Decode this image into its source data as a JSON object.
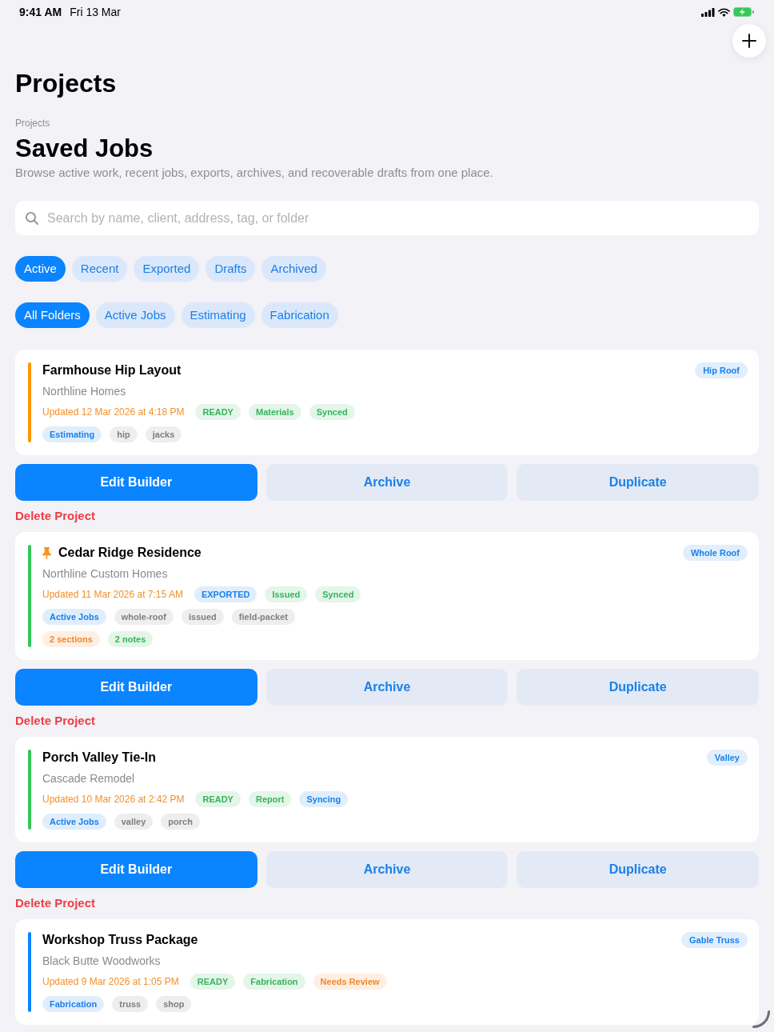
{
  "status_bar": {
    "time": "9:41 AM",
    "date": "Fri 13 Mar"
  },
  "header": {
    "title": "Projects"
  },
  "section": {
    "eyebrow": "Projects",
    "title": "Saved Jobs",
    "description": "Browse active work, recent jobs, exports, archives, and recoverable drafts from one place."
  },
  "search": {
    "placeholder": "Search by name, client, address, tag, or folder"
  },
  "status_filters": [
    {
      "label": "Active",
      "selected": true
    },
    {
      "label": "Recent",
      "selected": false
    },
    {
      "label": "Exported",
      "selected": false
    },
    {
      "label": "Drafts",
      "selected": false
    },
    {
      "label": "Archived",
      "selected": false
    }
  ],
  "folder_filters": [
    {
      "label": "All Folders",
      "selected": true
    },
    {
      "label": "Active Jobs",
      "selected": false
    },
    {
      "label": "Estimating",
      "selected": false
    },
    {
      "label": "Fabrication",
      "selected": false
    }
  ],
  "projects": [
    {
      "title": "Farmhouse Hip Layout",
      "pinned": false,
      "color": "#ff9500",
      "client": "Northline Homes",
      "badge": "Hip Roof",
      "updated": "Updated 12 Mar 2026 at 4:18 PM",
      "status_chips": [
        {
          "label": "READY",
          "color": "#35b55a"
        },
        {
          "label": "Materials",
          "color": "#35b55a"
        },
        {
          "label": "Synced",
          "color": "#35b55a"
        }
      ],
      "tag_rows": [
        {
          "tags": [
            {
              "label": "Estimating",
              "color": "#1a80ea"
            },
            {
              "label": "hip",
              "color": "#7e7e83"
            },
            {
              "label": "jacks",
              "color": "#7e7e83"
            }
          ]
        }
      ],
      "actions": [
        {
          "label": "Edit Builder",
          "kind": "primary"
        },
        {
          "label": "Archive",
          "kind": "secondary"
        },
        {
          "label": "Duplicate",
          "kind": "secondary"
        }
      ],
      "delete": "Delete Project"
    },
    {
      "title": "Cedar Ridge Residence",
      "pinned": true,
      "color": "#34c759",
      "client": "Northline Custom Homes",
      "badge": "Whole Roof",
      "updated": "Updated 11 Mar 2026 at 7:15 AM",
      "status_chips": [
        {
          "label": "EXPORTED",
          "color": "#1a80ea"
        },
        {
          "label": "Issued",
          "color": "#35b55a"
        },
        {
          "label": "Synced",
          "color": "#35b55a"
        }
      ],
      "tag_rows": [
        {
          "tags": [
            {
              "label": "Active Jobs",
              "color": "#1a80ea"
            },
            {
              "label": "whole-roof",
              "color": "#7e7e83"
            },
            {
              "label": "issued",
              "color": "#7e7e83"
            },
            {
              "label": "field-packet",
              "color": "#7e7e83"
            }
          ]
        },
        {
          "tags": [
            {
              "label": "2 sections",
              "color": "#f0892a"
            },
            {
              "label": "2 notes",
              "color": "#35b55a"
            }
          ]
        }
      ],
      "actions": [
        {
          "label": "Edit Builder",
          "kind": "primary"
        },
        {
          "label": "Archive",
          "kind": "secondary"
        },
        {
          "label": "Duplicate",
          "kind": "secondary"
        }
      ],
      "delete": "Delete Project"
    },
    {
      "title": "Porch Valley Tie-In",
      "pinned": false,
      "color": "#34c759",
      "client": "Cascade Remodel",
      "badge": "Valley",
      "updated": "Updated 10 Mar 2026 at 2:42 PM",
      "status_chips": [
        {
          "label": "READY",
          "color": "#35b55a"
        },
        {
          "label": "Report",
          "color": "#35b55a"
        },
        {
          "label": "Syncing",
          "color": "#1a80ea"
        }
      ],
      "tag_rows": [
        {
          "tags": [
            {
              "label": "Active Jobs",
              "color": "#1a80ea"
            },
            {
              "label": "valley",
              "color": "#7e7e83"
            },
            {
              "label": "porch",
              "color": "#7e7e83"
            }
          ]
        }
      ],
      "actions": [
        {
          "label": "Edit Builder",
          "kind": "primary"
        },
        {
          "label": "Archive",
          "kind": "secondary"
        },
        {
          "label": "Duplicate",
          "kind": "secondary"
        }
      ],
      "delete": "Delete Project"
    },
    {
      "title": "Workshop Truss Package",
      "pinned": false,
      "color": "#0a84ff",
      "client": "Black Butte Woodworks",
      "badge": "Gable Truss",
      "updated": "Updated 9 Mar 2026 at 1:05 PM",
      "status_chips": [
        {
          "label": "READY",
          "color": "#35b55a"
        },
        {
          "label": "Fabrication",
          "color": "#35b55a"
        },
        {
          "label": "Needs Review",
          "color": "#f0892a"
        }
      ],
      "tag_rows": [
        {
          "tags": [
            {
              "label": "Fabrication",
              "color": "#1a80ea"
            },
            {
              "label": "truss",
              "color": "#7e7e83"
            },
            {
              "label": "shop",
              "color": "#7e7e83"
            }
          ]
        }
      ]
    }
  ]
}
